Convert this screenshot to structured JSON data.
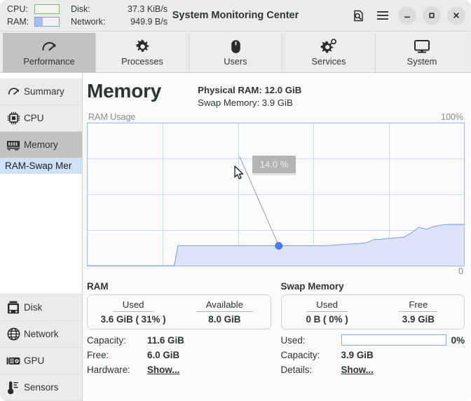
{
  "window": {
    "title": "System Monitoring Center",
    "header_icons": [
      {
        "name": "document-search-icon",
        "glyph": "search"
      },
      {
        "name": "hamburger-menu-icon",
        "glyph": "menu"
      }
    ],
    "controls": [
      {
        "name": "minimize-button",
        "glyph": "–"
      },
      {
        "name": "maximize-button",
        "glyph": "□"
      },
      {
        "name": "close-button",
        "glyph": "✕"
      }
    ]
  },
  "mini_monitors": {
    "cpu_label": "CPU:",
    "cpu_percent": 0,
    "cpu_color": "#7ec05a",
    "ram_label": "RAM:",
    "ram_percent": 31,
    "ram_color": "#7d9fe8",
    "disk_label": "Disk:",
    "disk_value": "37.3 KiB/s",
    "network_label": "Network:",
    "network_value": "949.9 B/s"
  },
  "tabs": [
    {
      "label": "Performance",
      "icon": "gauge-icon",
      "active": true
    },
    {
      "label": "Processes",
      "icon": "gear-icon",
      "active": false
    },
    {
      "label": "Users",
      "icon": "mouse-icon",
      "active": false
    },
    {
      "label": "Services",
      "icon": "gears-icon",
      "active": false
    },
    {
      "label": "System",
      "icon": "monitor-icon",
      "active": false
    }
  ],
  "sidebar": {
    "top_items": [
      {
        "label": "Summary",
        "icon": "gauge-icon",
        "active": false
      },
      {
        "label": "CPU",
        "icon": "cpu-chip-icon",
        "active": false
      },
      {
        "label": "Memory",
        "icon": "ram-stick-icon",
        "active": true
      }
    ],
    "sub_item": {
      "label": "RAM-Swap Mer",
      "selected": true
    },
    "bottom_items": [
      {
        "label": "Disk",
        "icon": "disk-icon",
        "active": false
      },
      {
        "label": "Network",
        "icon": "globe-icon",
        "active": false
      },
      {
        "label": "GPU",
        "icon": "gpu-card-icon",
        "active": false
      },
      {
        "label": "Sensors",
        "icon": "thermometer-icon",
        "active": false
      }
    ]
  },
  "main": {
    "title": "Memory",
    "physical_ram": "Physical RAM: 12.0 GiB",
    "swap_memory": "Swap Memory: 3.9 GiB"
  },
  "chart_data": {
    "type": "area",
    "title": "RAM Usage",
    "ylabel": "RAM Usage",
    "ytop_label": "100%",
    "ybottom_label": "0",
    "ylim": [
      0,
      100
    ],
    "grid": true,
    "line_color": "#6d93ec",
    "fill_color": "#dde4fa",
    "tooltip": {
      "text": "14.0 %",
      "value": 14.0
    },
    "marker": {
      "x_pct": 50.8,
      "value": 14.0
    },
    "x": [
      0,
      4,
      8,
      12,
      16,
      20,
      22,
      23,
      24,
      28,
      32,
      36,
      40,
      44,
      48,
      52,
      56,
      60,
      64,
      68,
      72,
      74,
      76,
      78,
      80,
      82,
      84,
      86,
      88,
      90,
      92,
      94,
      96,
      98,
      100
    ],
    "values": [
      0,
      0,
      0,
      0,
      0,
      0,
      0,
      0,
      14.0,
      14.0,
      14.0,
      14.0,
      14.0,
      14.0,
      14.0,
      14.0,
      14.0,
      14.0,
      14.2,
      15.0,
      15.6,
      16.0,
      18.4,
      18.6,
      19.2,
      19.6,
      20.0,
      23.0,
      27.0,
      25.6,
      27.5,
      28.6,
      29.0,
      29.0,
      29.0
    ]
  },
  "ram_panel": {
    "title": "RAM",
    "box": [
      {
        "key": "Used",
        "value": "3.6 GiB  ( 31% )"
      },
      {
        "key": "Available",
        "value": "8.0 GiB"
      }
    ],
    "rows": [
      {
        "key": "Capacity:",
        "value": "11.6 GiB",
        "type": "text"
      },
      {
        "key": "Free:",
        "value": "6.0 GiB",
        "type": "text"
      },
      {
        "key": "Hardware:",
        "value": "Show...",
        "type": "link"
      }
    ]
  },
  "swap_panel": {
    "title": "Swap Memory",
    "box": [
      {
        "key": "Used",
        "value": "0 B  ( 0% )"
      },
      {
        "key": "Free",
        "value": "3.9 GiB"
      }
    ],
    "used_label": "Used:",
    "used_percent": 0,
    "used_percent_text": "0%",
    "rows": [
      {
        "key": "Capacity:",
        "value": "3.9 GiB",
        "type": "text"
      },
      {
        "key": "Details:",
        "value": "Show...",
        "type": "link"
      }
    ]
  }
}
